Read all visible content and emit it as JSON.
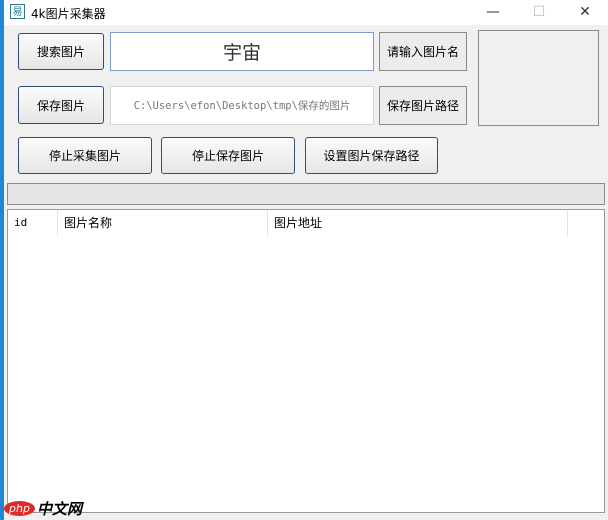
{
  "window": {
    "title": "4k图片采集器",
    "minimize": "—",
    "maximize": "☐",
    "close": "✕"
  },
  "row1": {
    "search_button": "搜索图片",
    "keyword_value": "宇宙",
    "keyword_label": "请输入图片名"
  },
  "row2": {
    "save_button": "保存图片",
    "path_value": "C:\\Users\\efon\\Desktop\\tmp\\保存的图片",
    "path_label": "保存图片路径"
  },
  "row3": {
    "stop_collect": "停止采集图片",
    "stop_save": "停止保存图片",
    "set_path": "设置图片保存路径"
  },
  "progress": 0,
  "table": {
    "columns": [
      "id",
      "图片名称",
      "图片地址"
    ],
    "rows": []
  },
  "watermark": {
    "logo": "php",
    "text": "中文网"
  }
}
